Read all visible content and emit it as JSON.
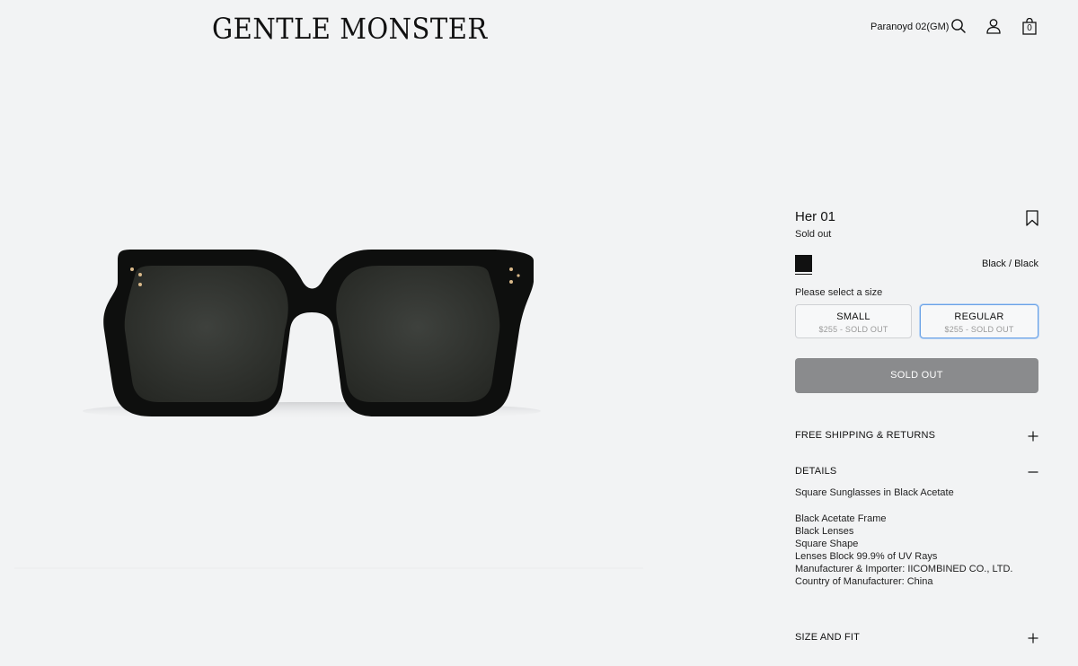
{
  "header": {
    "logo": "GENTLE MONSTER",
    "store_name": "Paranoyd 02(GM)",
    "cart_count": "0",
    "icons": [
      "search-icon",
      "account-icon",
      "shopping-bag-icon"
    ]
  },
  "product": {
    "image_alt": "Black square sunglasses with dark lenses",
    "title": "Her 01",
    "status": "Sold out",
    "color": {
      "swatch_hex": "#111111",
      "label": "Black / Black"
    },
    "size_prompt": "Please select a size",
    "sizes": [
      {
        "name": "SMALL",
        "price_status": "$255 - SOLD OUT",
        "selected": false
      },
      {
        "name": "REGULAR",
        "price_status": "$255 - SOLD OUT",
        "selected": true
      }
    ],
    "cta_label": "SOLD OUT"
  },
  "accordions": {
    "shipping": {
      "label": "FREE SHIPPING & RETURNS",
      "state": "collapsed"
    },
    "details": {
      "label": "DETAILS",
      "state": "expanded",
      "lead": "Square Sunglasses in Black Acetate",
      "items": [
        "Black Acetate Frame",
        "Black Lenses",
        "Square Shape",
        "Lenses Block 99.9% of UV Rays",
        "Manufacturer & Importer: IICOMBINED CO., LTD.",
        "Country of Manufacturer: China"
      ]
    },
    "size_fit": {
      "label": "SIZE AND FIT",
      "state": "collapsed"
    }
  },
  "colors": {
    "background": "#f2f3f4",
    "text": "#111111",
    "sold_out_button": "#8a8b8d",
    "selected_border": "#6aa2e6"
  }
}
